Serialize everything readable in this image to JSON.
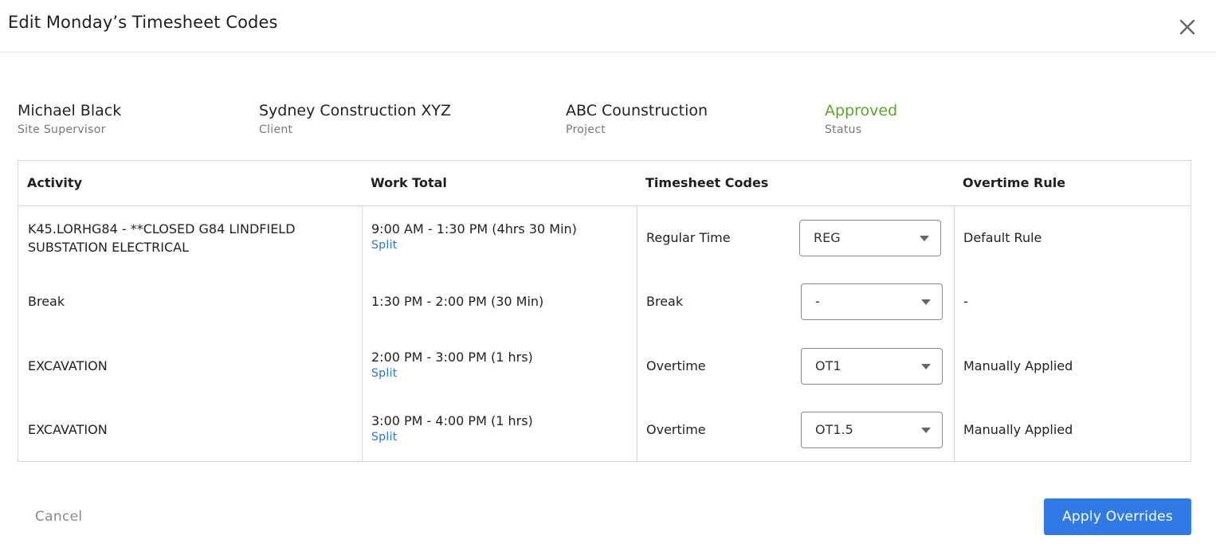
{
  "dialog": {
    "title": "Edit Monday’s Timesheet Codes",
    "close_icon": "close-icon"
  },
  "info": {
    "supervisor": {
      "value": "Michael Black",
      "label": "Site Supervisor"
    },
    "client": {
      "value": "Sydney Construction XYZ",
      "label": "Client"
    },
    "project": {
      "value": "ABC Counstruction",
      "label": "Project"
    },
    "status": {
      "value": "Approved",
      "label": "Status",
      "color": "#5aa62c"
    }
  },
  "table": {
    "headers": [
      "Activity",
      "Work Total",
      "Timesheet Codes",
      "Overtime Rule"
    ],
    "rows": [
      {
        "activity_line1": "K45.LORHG84 - **CLOSED G84 LINDFIELD",
        "activity_line2": "SUBSTATION ELECTRICAL",
        "work_total": "9:00 AM - 1:30 PM (4hrs 30 Min)",
        "split": "Split",
        "code_label": "Regular Time",
        "code_value": "REG",
        "overtime_rule": "Default Rule"
      },
      {
        "activity_line1": "Break",
        "work_total": "1:30 PM - 2:00 PM (30 Min)",
        "code_label": "Break",
        "code_value": "-",
        "overtime_rule": "-"
      },
      {
        "activity_line1": "EXCAVATION",
        "work_total": "2:00 PM - 3:00 PM (1 hrs)",
        "split": "Split",
        "code_label": "Overtime",
        "code_value": "OT1",
        "overtime_rule": "Manually Applied"
      },
      {
        "activity_line1": "EXCAVATION",
        "work_total": "3:00 PM - 4:00 PM (1 hrs)",
        "split": "Split",
        "code_label": "Overtime",
        "code_value": "OT1.5",
        "overtime_rule": "Manually Applied"
      }
    ]
  },
  "footer": {
    "cancel_label": "Cancel",
    "apply_label": "Apply Overrides",
    "accent_color": "#2f7ae5"
  }
}
